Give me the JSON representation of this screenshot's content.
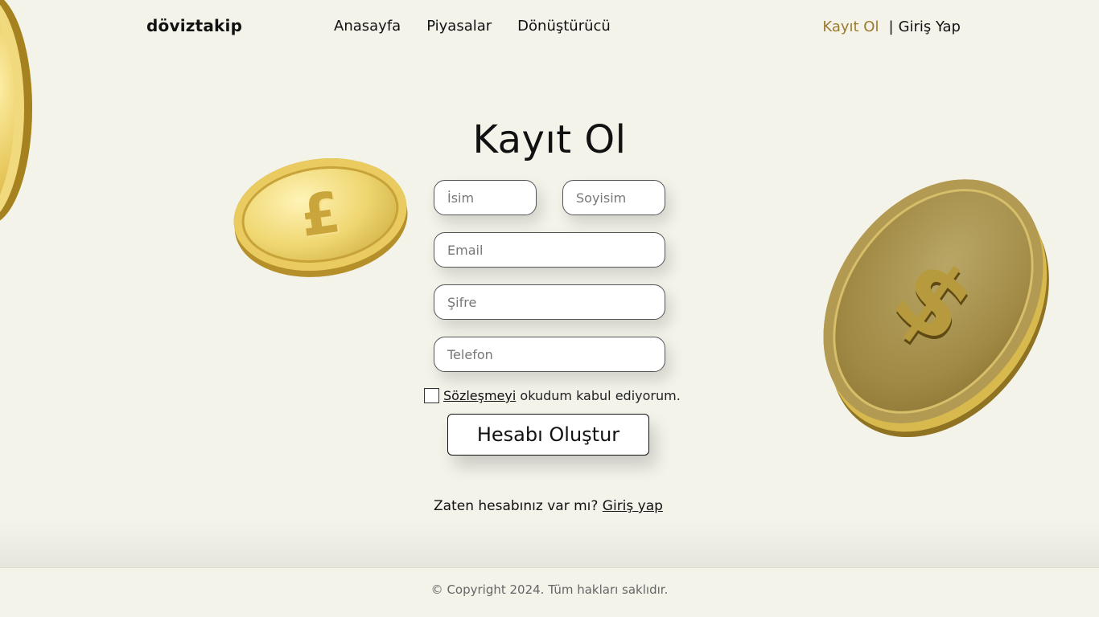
{
  "header": {
    "logo": "döviztakip",
    "nav": [
      "Anasayfa",
      "Piyasalar",
      "Dönüştürücü"
    ],
    "register_label": "Kayıt Ol",
    "separator": "|",
    "login_label": "Giriş Yap",
    "accent_color": "#9c7a2e"
  },
  "form": {
    "title": "Kayıt Ol",
    "name_placeholder": "İsim",
    "surname_placeholder": "Soyisim",
    "email_placeholder": "Email",
    "password_placeholder": "Şifre",
    "phone_placeholder": "Telefon",
    "agreement_link": "Sözleşmeyi",
    "agreement_text": " okudum kabul ediyorum.",
    "submit_label": "Hesabı Oluştur"
  },
  "login_prompt": {
    "text": "Zaten hesabınız var mı? ",
    "link": "Giriş yap"
  },
  "coins": {
    "left_symbol": "£",
    "right_symbol": "$"
  },
  "footer": {
    "copyright": "© Copyright 2024. Tüm hakları saklıdır."
  }
}
